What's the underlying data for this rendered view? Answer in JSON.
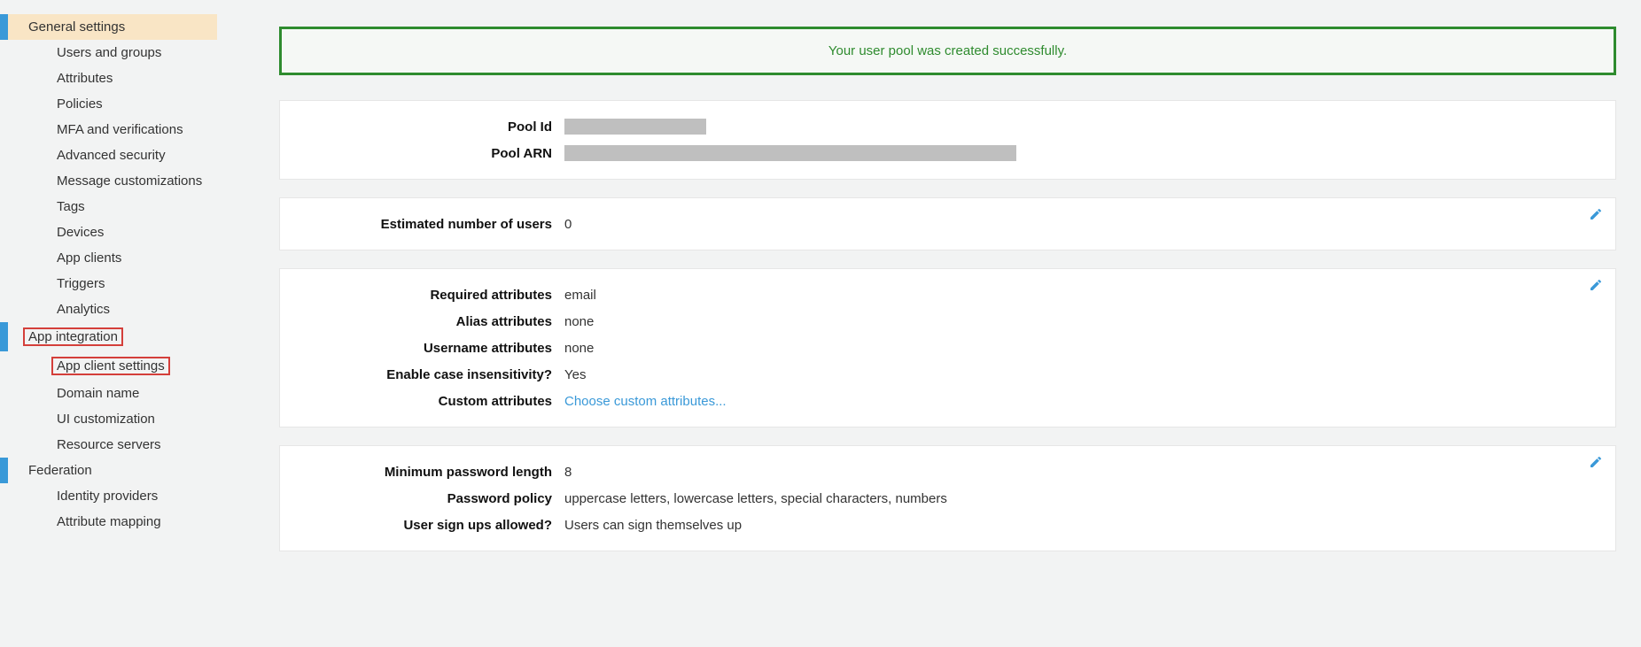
{
  "sidebar": {
    "general_settings": "General settings",
    "items_general": [
      "Users and groups",
      "Attributes",
      "Policies",
      "MFA and verifications",
      "Advanced security",
      "Message customizations",
      "Tags",
      "Devices",
      "App clients",
      "Triggers",
      "Analytics"
    ],
    "app_integration": "App integration",
    "items_app_integration": [
      "App client settings",
      "Domain name",
      "UI customization",
      "Resource servers"
    ],
    "federation": "Federation",
    "items_federation": [
      "Identity providers",
      "Attribute mapping"
    ]
  },
  "alert": {
    "message": "Your user pool was created successfully."
  },
  "pool": {
    "id_label": "Pool Id",
    "arn_label": "Pool ARN"
  },
  "users": {
    "estimated_label": "Estimated number of users",
    "estimated_value": "0"
  },
  "attributes": {
    "required_label": "Required attributes",
    "required_value": "email",
    "alias_label": "Alias attributes",
    "alias_value": "none",
    "username_label": "Username attributes",
    "username_value": "none",
    "case_label": "Enable case insensitivity?",
    "case_value": "Yes",
    "custom_label": "Custom attributes",
    "custom_link": "Choose custom attributes..."
  },
  "password": {
    "minlen_label": "Minimum password length",
    "minlen_value": "8",
    "policy_label": "Password policy",
    "policy_value": "uppercase letters, lowercase letters, special characters, numbers",
    "signup_label": "User sign ups allowed?",
    "signup_value": "Users can sign themselves up"
  }
}
